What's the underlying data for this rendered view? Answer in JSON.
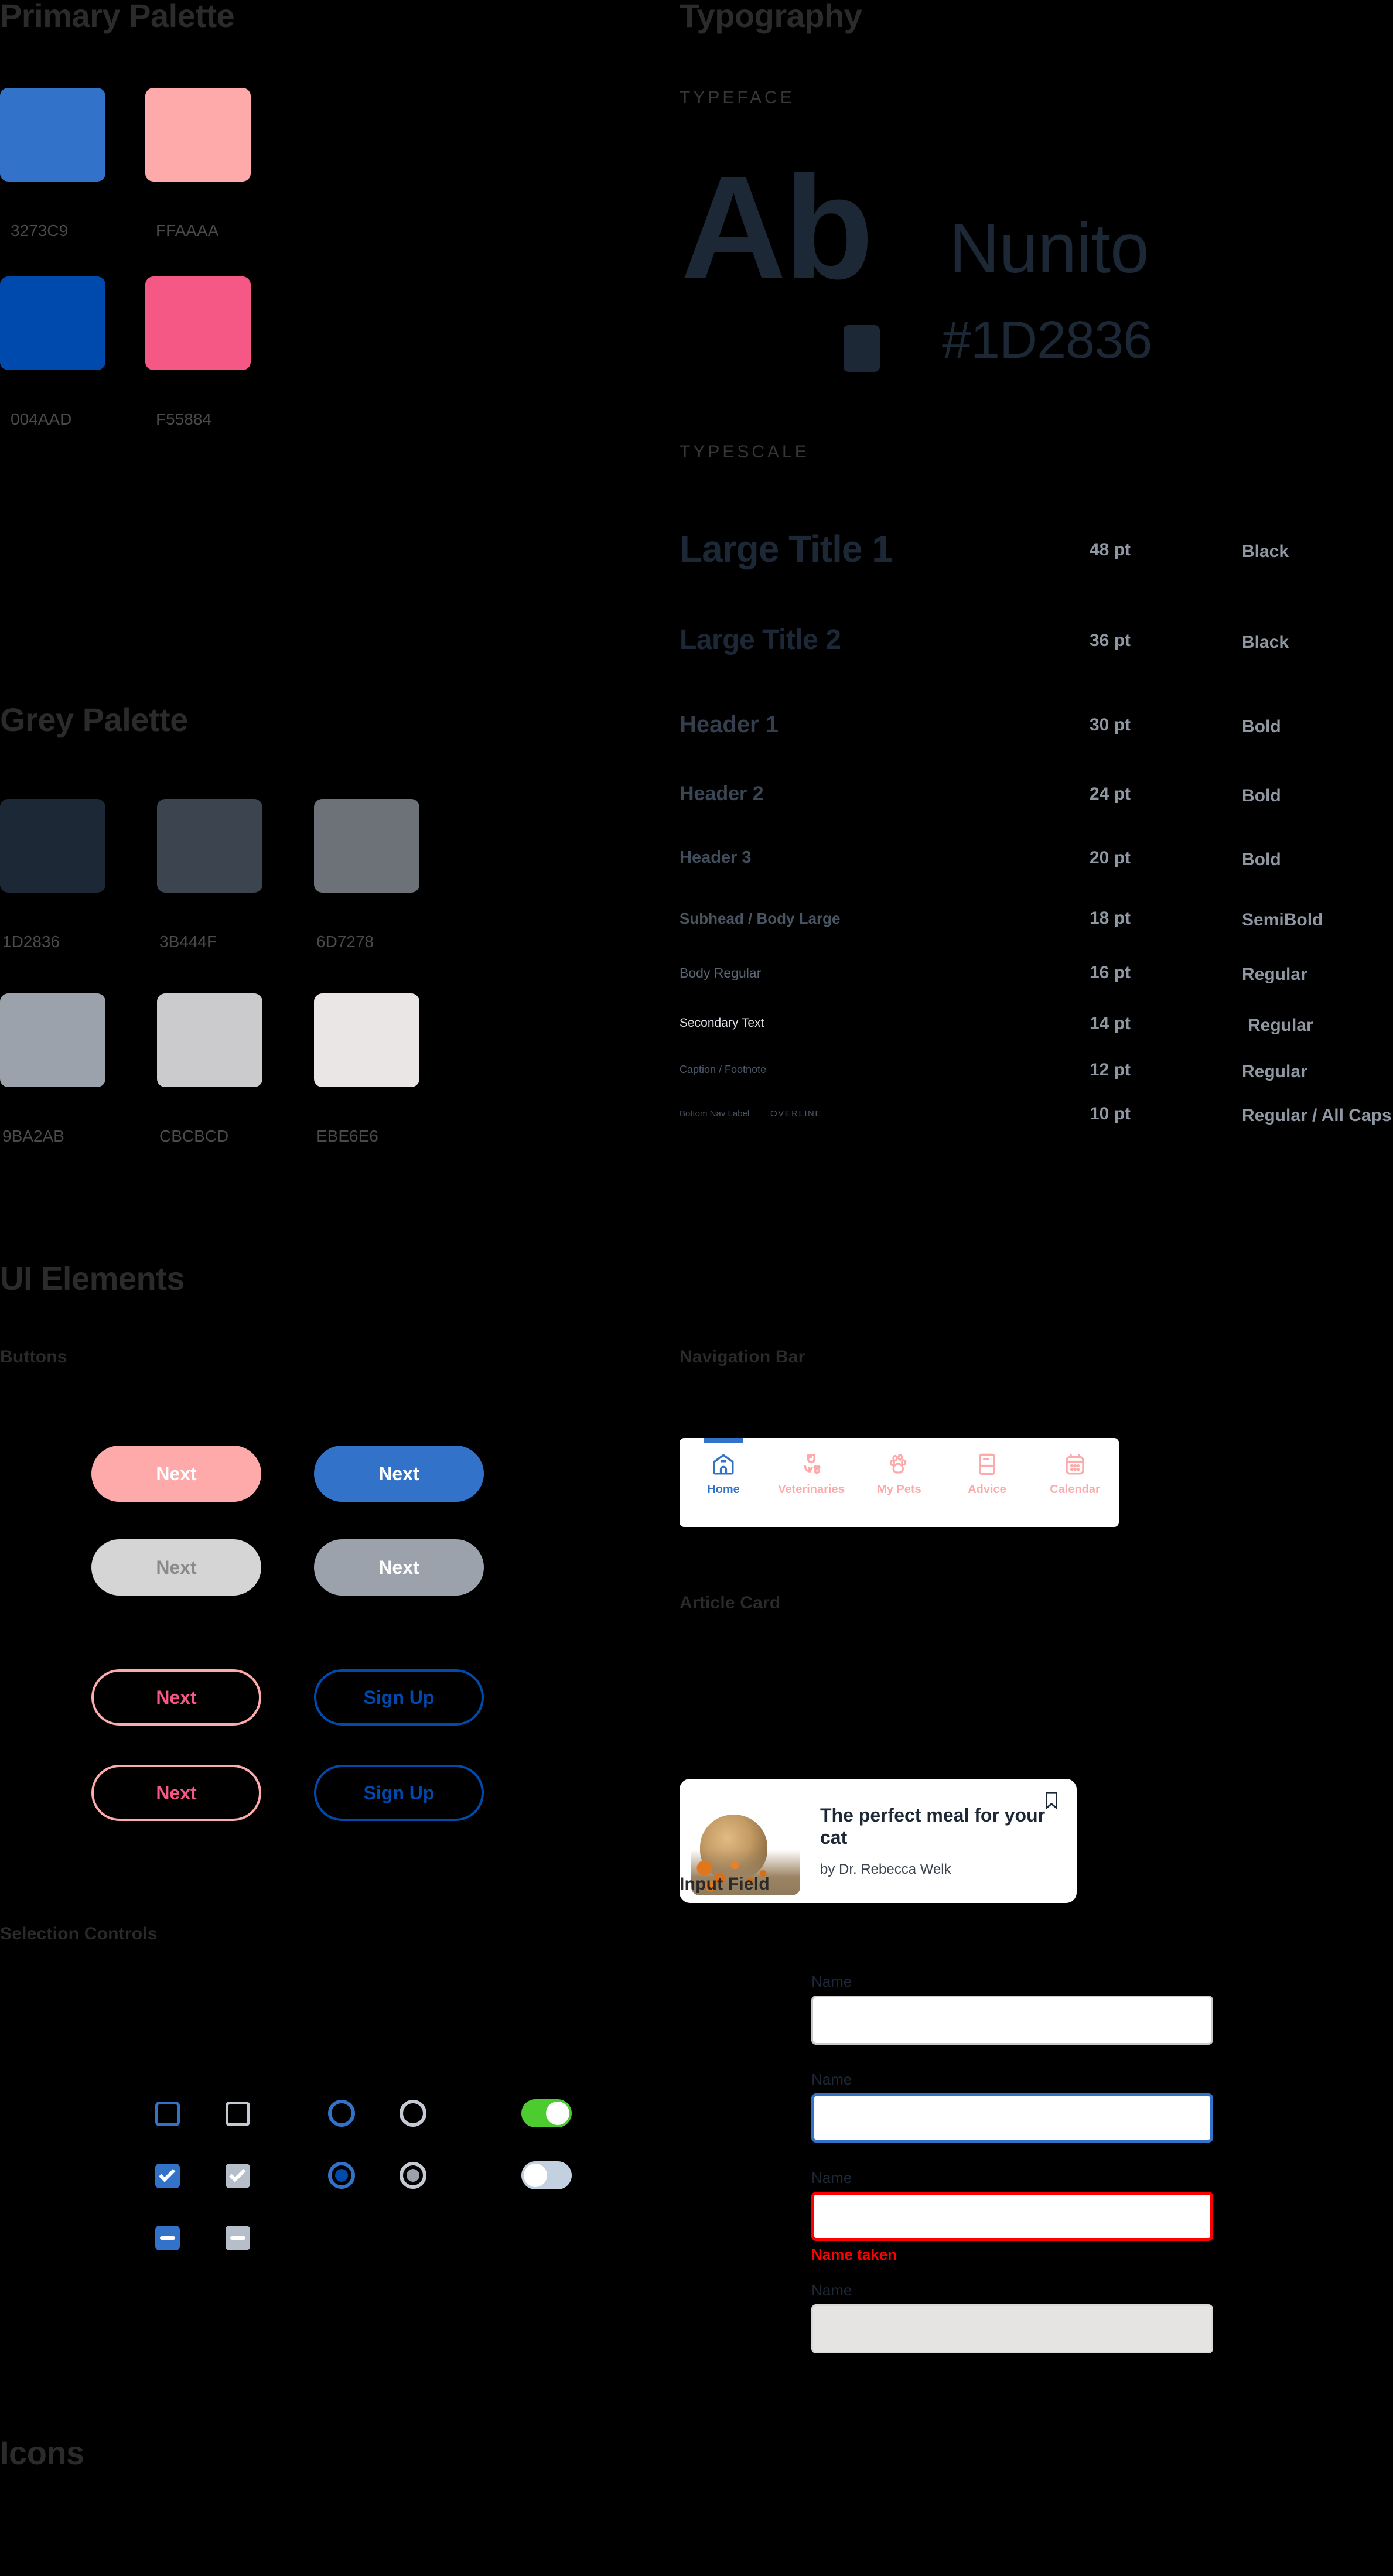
{
  "sections": {
    "primary_palette": "Primary Palette",
    "grey_palette": "Grey Palette",
    "typography": "Typography",
    "ui_elements": "UI Elements",
    "icons": "Icons",
    "typeface": "TYPEFACE",
    "typescale": "TYPESCALE",
    "buttons": "Buttons",
    "selection_controls": "Selection Controls",
    "navigation_bar": "Navigation Bar",
    "article_card": "Article Card",
    "input_field": "Input Field"
  },
  "primary_palette": [
    {
      "hex": "3273C9",
      "color": "#3273C9"
    },
    {
      "hex": "FFAAAA",
      "color": "#FFAAAA"
    },
    {
      "hex": "004AAD",
      "color": "#004AAD"
    },
    {
      "hex": "F55884",
      "color": "#F55884"
    }
  ],
  "grey_palette": [
    {
      "hex": "1D2836",
      "color": "#1D2836"
    },
    {
      "hex": "3B444F",
      "color": "#3B444F"
    },
    {
      "hex": "6D7278",
      "color": "#6D7278"
    },
    {
      "hex": "9BA2AB",
      "color": "#9BA2AB"
    },
    {
      "hex": "CBCBCD",
      "color": "#CBCBCD"
    },
    {
      "hex": "EBE6E6",
      "color": "#EBE6E6"
    }
  ],
  "typeface": {
    "glyph_sample": "Ab",
    "name": "Nunito",
    "hex": "#1D2836"
  },
  "typescale": [
    {
      "sample": "Large Title 1",
      "size": "48 pt",
      "weight": "Black"
    },
    {
      "sample": "Large Title 2",
      "size": "36 pt",
      "weight": "Black"
    },
    {
      "sample": "Header 1",
      "size": "30 pt",
      "weight": "Bold"
    },
    {
      "sample": "Header 2",
      "size": "24 pt",
      "weight": "Bold"
    },
    {
      "sample": "Header 3",
      "size": "20 pt",
      "weight": "Bold"
    },
    {
      "sample": "Subhead / Body Large",
      "size": "18 pt",
      "weight": "SemiBold"
    },
    {
      "sample": "Body Regular",
      "size": "16 pt",
      "weight": "Regular"
    },
    {
      "sample": "Secondary Text",
      "size": "14 pt",
      "weight": "Regular"
    },
    {
      "sample": "Caption / Footnote",
      "size": "12 pt",
      "weight": "Regular"
    },
    {
      "sample": "Bottom Nav Label",
      "sample2": "OVERLINE",
      "size": "10 pt",
      "weight": "Regular / All Caps"
    }
  ],
  "buttons": [
    {
      "label": "Next",
      "style": "filled-pink",
      "bg": "#FFAAAA",
      "fg": "#FFFFFF"
    },
    {
      "label": "Next",
      "style": "filled-blue",
      "bg": "#3273C9",
      "fg": "#FFFFFF"
    },
    {
      "label": "Next",
      "style": "filled-grey",
      "bg": "#D5D5D5",
      "fg": "#8A8A8A"
    },
    {
      "label": "Next",
      "style": "filled-slate",
      "bg": "#9BA2AB",
      "fg": "#FFFFFF"
    },
    {
      "label": "Next",
      "style": "outline-pink",
      "bg": "#FFAAAA",
      "fg": "#F55884"
    },
    {
      "label": "Sign Up",
      "style": "outline-blue",
      "bg": "#004AAD",
      "fg": "#004AAD"
    },
    {
      "label": "Next",
      "style": "outline-pink-2",
      "bg": "#FFAAAA",
      "fg": "#F55884"
    },
    {
      "label": "Sign Up",
      "style": "outline-blue-2",
      "bg": "#004AAD",
      "fg": "#004AAD"
    }
  ],
  "navigation": {
    "active_index": 0,
    "active_color": "#3273C9",
    "inactive_color": "#FFAAAA",
    "items": [
      {
        "label": "Home",
        "icon": "home-icon"
      },
      {
        "label": "Veterinaries",
        "icon": "veterinary-icon"
      },
      {
        "label": "My Pets",
        "icon": "paw-icon"
      },
      {
        "label": "Advice",
        "icon": "article-icon"
      },
      {
        "label": "Calendar",
        "icon": "calendar-icon"
      }
    ]
  },
  "article_card": {
    "title": "The perfect meal for your cat",
    "author": "by Dr. Rebecca Welk",
    "bookmark_icon": "bookmark-icon"
  },
  "input_fields": [
    {
      "label": "Name",
      "value": "",
      "state": "default",
      "border": "#CBCBCD",
      "bg": "#FFFFFF",
      "error": ""
    },
    {
      "label": "Name",
      "value": "",
      "state": "focused",
      "border": "#3273C9",
      "bg": "#FFFFFF",
      "error": ""
    },
    {
      "label": "Name",
      "value": "",
      "state": "error",
      "border": "#FF0000",
      "bg": "#FFFFFF",
      "error": "Name taken"
    },
    {
      "label": "Name",
      "value": "",
      "state": "disabled",
      "border": "#CBCBCD",
      "bg": "#E6E3E3",
      "error": ""
    }
  ],
  "selection_controls": {
    "checkbox_active_color": "#3273C9",
    "checkbox_disabled_color": "#B6BEC9",
    "radio_active_color": "#3273C9",
    "radio_selected_color": "#004AAD",
    "radio_disabled_color": "#C3CAD3",
    "radio_disabled_dot": "#9BA2AB",
    "toggle_on_color": "#4DCC30",
    "toggle_off_color": "#C3D0DF"
  }
}
